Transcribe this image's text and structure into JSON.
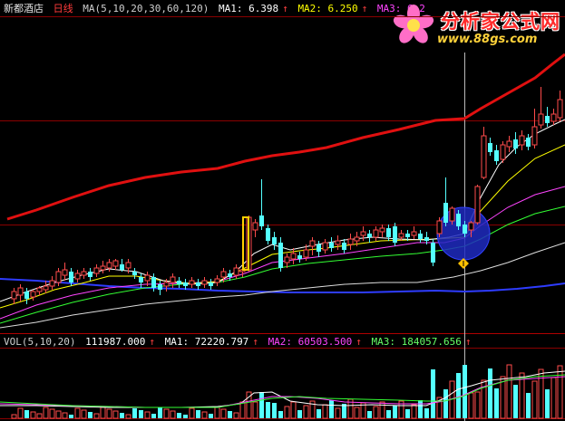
{
  "header": {
    "stock": "新都酒店",
    "period": "日线",
    "ma_label": "MA(5,10,20,30,60,120)",
    "ma1": "MA1: 6.398",
    "ma2": "MA2: 6.250",
    "ma3": "MA3: 6.2",
    "arrow": "↑"
  },
  "volume_header": {
    "label": "VOL(5,10,20)",
    "value": "111987.000",
    "ma1": "MA1: 72220.797",
    "ma2": "MA2: 60503.500",
    "ma3": "MA3: 184057.656",
    "arrow": "↑"
  },
  "watermark": {
    "title": "分析家公式网",
    "url": "www.88gs.com"
  },
  "colors": {
    "background": "#000000",
    "grid": "#8b0000",
    "up_candle": "#ff4b4b",
    "down_candle": "#54ffff",
    "ma_short": "#ffffff",
    "ma_mid": "#ffff00",
    "ma_pink": "#ff44ff",
    "ma_green": "#33ff33",
    "ma_light": "#dddddd",
    "ma_blue": "#2e3cff",
    "ma_red_long": "#e01010",
    "highlight_circle": "#2030c8"
  }
}
